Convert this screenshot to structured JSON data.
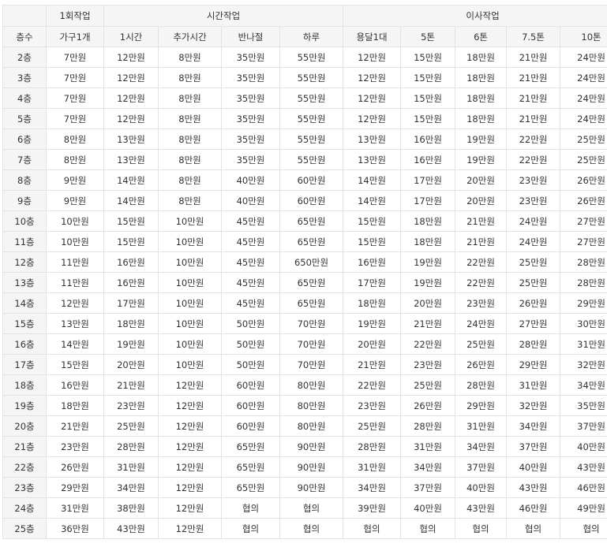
{
  "header": {
    "groups": [
      {
        "label": "",
        "span": 1
      },
      {
        "label": "1회작업",
        "span": 1
      },
      {
        "label": "시간작업",
        "span": 4
      },
      {
        "label": "이사작업",
        "span": 5
      }
    ],
    "columns": [
      "층수",
      "가구1개",
      "1시간",
      "추가시간",
      "반나절",
      "하루",
      "용달1대",
      "5톤",
      "6톤",
      "7.5톤",
      "10톤"
    ]
  },
  "rows": [
    [
      "2층",
      "7만원",
      "12만원",
      "8만원",
      "35만원",
      "55만원",
      "12만원",
      "15만원",
      "18만원",
      "21만원",
      "24만원"
    ],
    [
      "3층",
      "7만원",
      "12만원",
      "8만원",
      "35만원",
      "55만원",
      "12만원",
      "15만원",
      "18만원",
      "21만원",
      "24만원"
    ],
    [
      "4층",
      "7만원",
      "12만원",
      "8만원",
      "35만원",
      "55만원",
      "12만원",
      "15만원",
      "18만원",
      "21만원",
      "24만원"
    ],
    [
      "5층",
      "7만원",
      "12만원",
      "8만원",
      "35만원",
      "55만원",
      "12만원",
      "15만원",
      "18만원",
      "21만원",
      "24만원"
    ],
    [
      "6층",
      "8만원",
      "13만원",
      "8만원",
      "35만원",
      "55만원",
      "13만원",
      "16만원",
      "19만원",
      "22만원",
      "25만원"
    ],
    [
      "7층",
      "8만원",
      "13만원",
      "8만원",
      "35만원",
      "55만원",
      "13만원",
      "16만원",
      "19만원",
      "22만원",
      "25만원"
    ],
    [
      "8층",
      "9만원",
      "14만원",
      "8만원",
      "40만원",
      "60만원",
      "14만원",
      "17만원",
      "20만원",
      "23만원",
      "26만원"
    ],
    [
      "9층",
      "9만원",
      "14만원",
      "8만원",
      "40만원",
      "60만원",
      "14만원",
      "17만원",
      "20만원",
      "23만원",
      "26만원"
    ],
    [
      "10층",
      "10만원",
      "15만원",
      "10만원",
      "45만원",
      "65만원",
      "15만원",
      "18만원",
      "21만원",
      "24만원",
      "27만원"
    ],
    [
      "11층",
      "10만원",
      "15만원",
      "10만원",
      "45만원",
      "65만원",
      "15만원",
      "18만원",
      "21만원",
      "24만원",
      "27만원"
    ],
    [
      "12층",
      "11만원",
      "16만원",
      "10만원",
      "45만원",
      "650만원",
      "16만원",
      "19만원",
      "22만원",
      "25만원",
      "28만원"
    ],
    [
      "13층",
      "11만원",
      "16만원",
      "10만원",
      "45만원",
      "65만원",
      "17만원",
      "19만원",
      "22만원",
      "25만원",
      "28만원"
    ],
    [
      "14층",
      "12만원",
      "17만원",
      "10만원",
      "45만원",
      "65만원",
      "18만원",
      "20만원",
      "23만원",
      "26만원",
      "29만원"
    ],
    [
      "15층",
      "13만원",
      "18만원",
      "10만원",
      "50만원",
      "70만원",
      "19만원",
      "21만원",
      "24만원",
      "27만원",
      "30만원"
    ],
    [
      "16층",
      "14만원",
      "19만원",
      "10만원",
      "50만원",
      "70만원",
      "20만원",
      "22만원",
      "25만원",
      "28만원",
      "31만원"
    ],
    [
      "17층",
      "15만원",
      "20만원",
      "10만원",
      "50만원",
      "70만원",
      "21만원",
      "23만원",
      "26만원",
      "29만원",
      "32만원"
    ],
    [
      "18층",
      "16만원",
      "21만원",
      "12만원",
      "60만원",
      "80만원",
      "22만원",
      "25만원",
      "28만원",
      "31만원",
      "34만원"
    ],
    [
      "19층",
      "18만원",
      "23만원",
      "12만원",
      "60만원",
      "80만원",
      "23만원",
      "26만원",
      "29만원",
      "32만원",
      "35만원"
    ],
    [
      "20층",
      "21만원",
      "25만원",
      "12만원",
      "60만원",
      "80만원",
      "25만원",
      "28만원",
      "31만원",
      "34만원",
      "37만원"
    ],
    [
      "21층",
      "23만원",
      "28만원",
      "12만원",
      "65만원",
      "90만원",
      "28만원",
      "31만원",
      "34만원",
      "37만원",
      "40만원"
    ],
    [
      "22층",
      "26만원",
      "31만원",
      "12만원",
      "65만원",
      "90만원",
      "31만원",
      "34만원",
      "37만원",
      "40만원",
      "43만원"
    ],
    [
      "23층",
      "29만원",
      "34만원",
      "12만원",
      "65만원",
      "90만원",
      "34만원",
      "37만원",
      "40만원",
      "43만원",
      "46만원"
    ],
    [
      "24층",
      "31만원",
      "38만원",
      "12만원",
      "협의",
      "협의",
      "39만원",
      "40만원",
      "43만원",
      "46만원",
      "49만원"
    ],
    [
      "25층",
      "36만원",
      "43만원",
      "12만원",
      "협의",
      "협의",
      "협의",
      "협의",
      "협의",
      "협의",
      "협의"
    ]
  ]
}
